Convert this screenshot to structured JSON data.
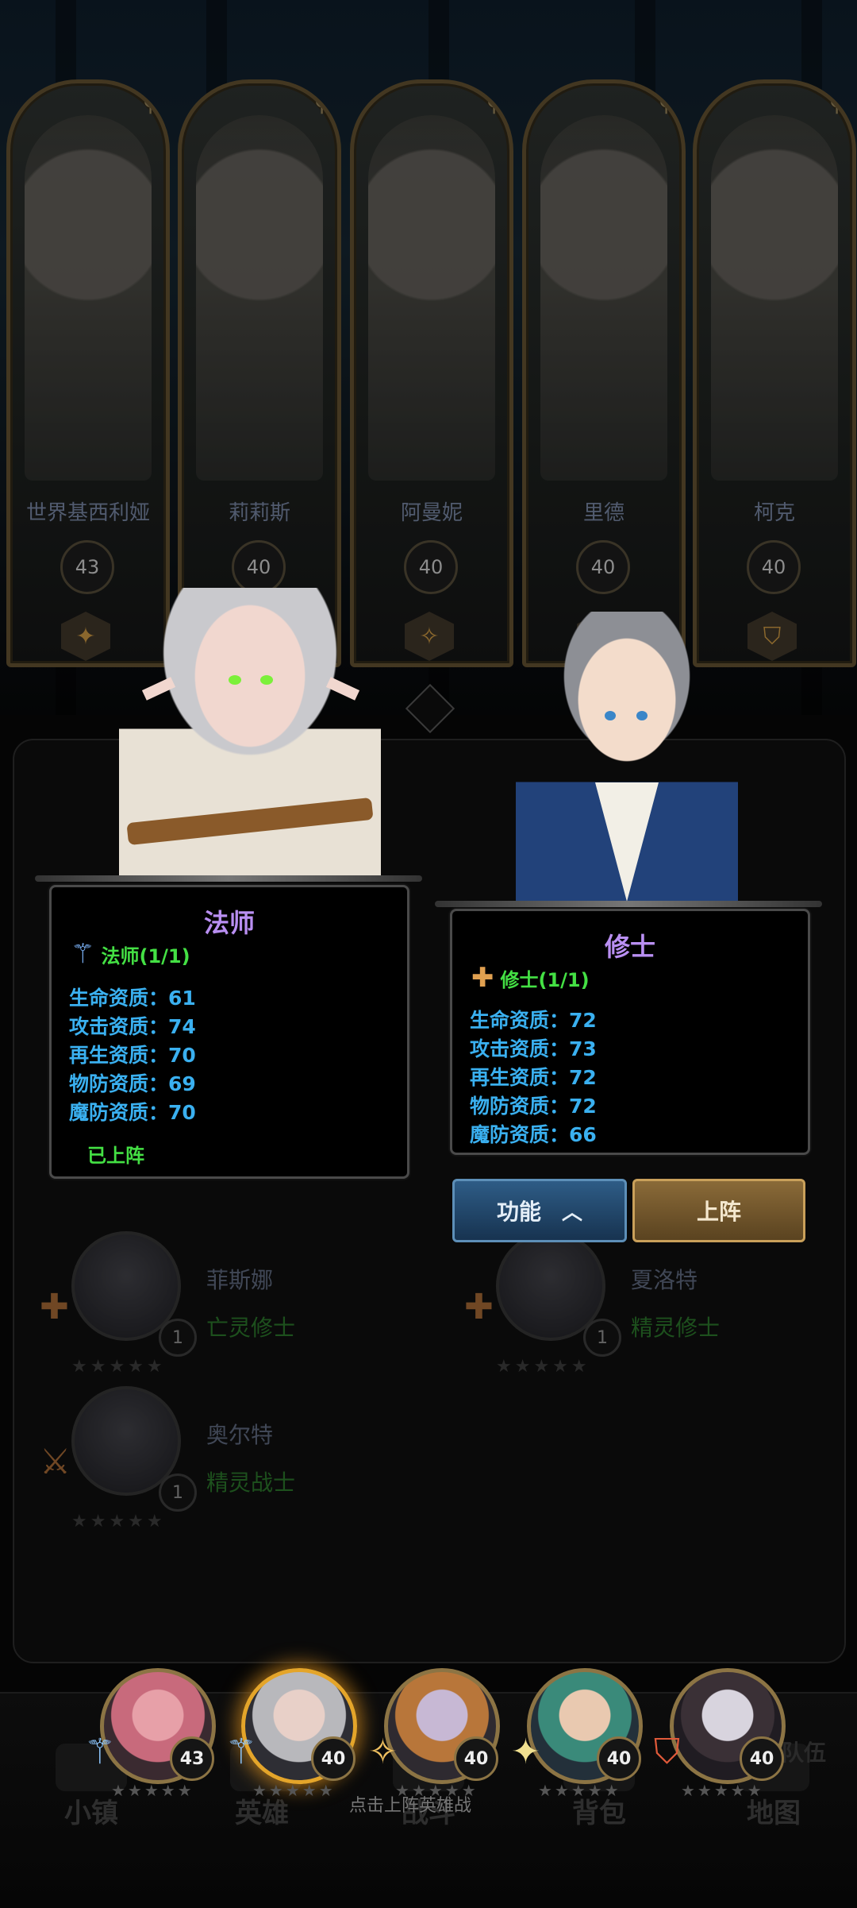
{
  "hero_cards": [
    {
      "name": "世界基西利娅",
      "level": "43",
      "class_icon": "staff-icon"
    },
    {
      "name": "莉莉斯",
      "level": "40",
      "class_icon": "staff-icon"
    },
    {
      "name": "阿曼妮",
      "level": "40",
      "class_icon": "compass-icon"
    },
    {
      "name": "里德",
      "level": "40",
      "class_icon": "cross-icon"
    },
    {
      "name": "柯克",
      "level": "40",
      "class_icon": "shield-icon"
    }
  ],
  "list": [
    {
      "name": "菲斯娜",
      "class": "亡灵修士",
      "level": "1",
      "class_icon": "cross-icon"
    },
    {
      "name": "夏洛特",
      "class": "精灵修士",
      "level": "1",
      "class_icon": "cross-icon"
    },
    {
      "name": "奥尔特",
      "class": "精灵战士",
      "level": "1",
      "class_icon": "sword-icon"
    }
  ],
  "popup_left": {
    "title": "法师",
    "tag": "法师(1/1)",
    "tag_icon": "staff-icon",
    "stats": [
      "生命资质：61",
      "攻击资质：74",
      "再生资质：70",
      "物防资质：69",
      "魔防资质：70"
    ],
    "status": "已上阵"
  },
  "popup_right": {
    "title": "修士",
    "tag": "修士(1/1)",
    "tag_icon": "cross-icon",
    "stats": [
      "生命资质：72",
      "攻击资质：73",
      "再生资质：72",
      "物防资质：72",
      "魔防资质：66"
    ]
  },
  "buttons": {
    "function": "功能",
    "deploy": "上阵"
  },
  "team": [
    {
      "level": "43",
      "class_icon": "staff-icon"
    },
    {
      "level": "40",
      "class_icon": "staff-icon"
    },
    {
      "level": "40",
      "class_icon": "compass-icon"
    },
    {
      "level": "40",
      "class_icon": "cross-icon"
    },
    {
      "level": "40",
      "class_icon": "shield-icon"
    }
  ],
  "hint": "点击上阵英雄战",
  "nav": {
    "town": "小镇",
    "hero": "英雄",
    "battle": "战斗",
    "bag": "背包",
    "map": "地图",
    "team": "队伍"
  },
  "colors": {
    "title_purple": "#b98ff2",
    "stat_blue": "#3ab0f0",
    "tag_green": "#44e044",
    "gold": "#c9a05a"
  }
}
